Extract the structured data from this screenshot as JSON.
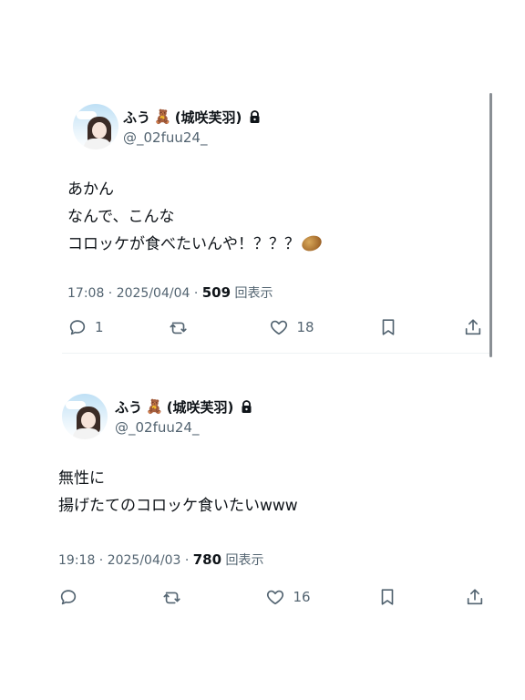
{
  "tweets": [
    {
      "display_name": "ふう",
      "display_name_suffix": "(城咲芙羽)",
      "emoji": "🧸",
      "handle": "@_02fuu24_",
      "text_lines": [
        "あかん",
        "なんで、こんな",
        "コロッケが食べたいんや！？？？"
      ],
      "trailing_emoji": "potato",
      "meta_time": "17:08 · 2025/04/04 · ",
      "views": "509",
      "views_label": "回表示",
      "reply_count": "1",
      "retweet_count": "",
      "like_count": "18"
    },
    {
      "display_name": "ふう",
      "display_name_suffix": "(城咲芙羽)",
      "emoji": "🧸",
      "handle": "@_02fuu24_",
      "text_lines": [
        "無性に",
        "揚げたてのコロッケ食いたいwww"
      ],
      "meta_time": "19:18 · 2025/04/03 · ",
      "views": "780",
      "views_label": "回表示",
      "reply_count": "",
      "retweet_count": "",
      "like_count": "16"
    }
  ],
  "icons": {
    "reply": "reply-icon",
    "retweet": "retweet-icon",
    "like": "heart-icon",
    "bookmark": "bookmark-icon",
    "share": "share-icon",
    "lock": "lock-icon"
  },
  "colors": {
    "text": "#0f1419",
    "secondary": "#536471",
    "divider": "#eff3f4"
  }
}
